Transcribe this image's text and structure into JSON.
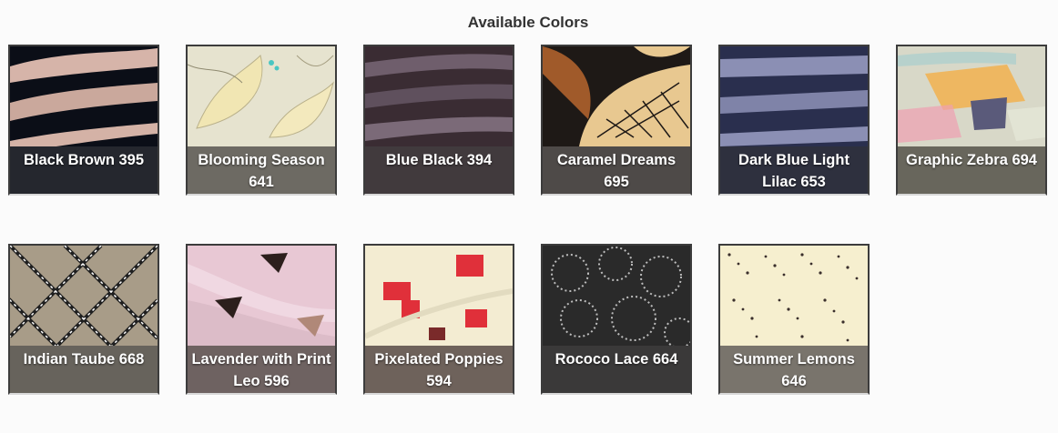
{
  "heading": "Available Colors",
  "swatches": [
    {
      "label": "Black Brown 395",
      "pattern": "black-brown-stripes",
      "label_bg": "#0d0f17",
      "colors": [
        "#0b0e17",
        "#d6b4a9"
      ]
    },
    {
      "label": "Blooming Season 641",
      "pattern": "blooming-florals",
      "label_bg": "#545048",
      "colors": [
        "#e6e3cf",
        "#f1e6b3",
        "#4ac6c2"
      ]
    },
    {
      "label": "Blue Black 394",
      "pattern": "blue-black-stripes",
      "label_bg": "#2c2528",
      "colors": [
        "#3a2c33",
        "#7b6a78"
      ]
    },
    {
      "label": "Caramel Dreams 695",
      "pattern": "caramel-leaves",
      "label_bg": "#2f2a28",
      "colors": [
        "#e8c890",
        "#1e1916",
        "#a05a2a"
      ]
    },
    {
      "label": "Dark Blue Light Lilac 653",
      "pattern": "dark-blue-lilac",
      "label_bg": "#1c1e2e",
      "colors": [
        "#2a2f4e",
        "#8b8fb4"
      ]
    },
    {
      "label": "Graphic Zebra 694",
      "pattern": "graphic-zebra",
      "label_bg": "#58554a",
      "colors": [
        "#d8d8c8",
        "#f2b24f",
        "#5a5a7a",
        "#f0a0b0"
      ]
    },
    {
      "label": "Indian Taube 668",
      "pattern": "indian-taube-lattice",
      "label_bg": "#4c4840",
      "colors": [
        "#a89c88",
        "#1f1f1f",
        "#ffffff"
      ]
    },
    {
      "label": "Lavender with Print Leo 596",
      "pattern": "lavender-print",
      "label_bg": "#665a58",
      "colors": [
        "#e8c8d4",
        "#2c1f1c",
        "#b08878"
      ]
    },
    {
      "label": "Pixelated Poppies 594",
      "pattern": "pixelated-poppies",
      "label_bg": "#55463e",
      "colors": [
        "#f3ecd2",
        "#e0303a",
        "#7a2a2a"
      ]
    },
    {
      "label": "Rococo Lace 664",
      "pattern": "rococo-lace",
      "label_bg": "#252424",
      "colors": [
        "#2a2a2a",
        "#bcbcbc"
      ]
    },
    {
      "label": "Summer Lemons 646",
      "pattern": "summer-lemons",
      "label_bg": "#625c52",
      "colors": [
        "#f6efcf",
        "#3a2f2c"
      ]
    }
  ]
}
